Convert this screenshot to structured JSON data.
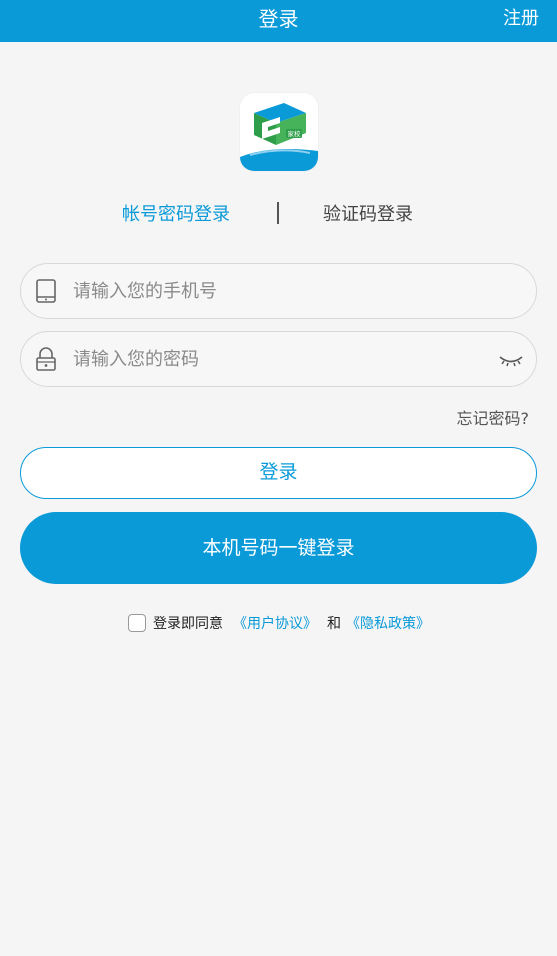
{
  "header": {
    "title": "登录",
    "register_label": "注册"
  },
  "colors": {
    "accent": "#0a9ad8",
    "background": "#f5f5f5"
  },
  "logo": {
    "icon": "app-logo-icon",
    "text": "家校"
  },
  "tabs": [
    {
      "label": "帐号密码登录",
      "active": true
    },
    {
      "label": "验证码登录",
      "active": false
    }
  ],
  "phone_field": {
    "icon": "tablet-icon",
    "placeholder": "请输入您的手机号",
    "value": ""
  },
  "password_field": {
    "icon": "lock-icon",
    "placeholder": "请输入您的密码",
    "value": "",
    "toggle_icon": "eye-closed-icon"
  },
  "forgot_password": "忘记密码?",
  "login_button": "登录",
  "one_click_login_button": "本机号码一键登录",
  "agreement": {
    "checked": false,
    "prefix": "登录即同意",
    "terms_link": "《用户协议》",
    "conjunction": "和",
    "privacy_link": "《隐私政策》"
  }
}
